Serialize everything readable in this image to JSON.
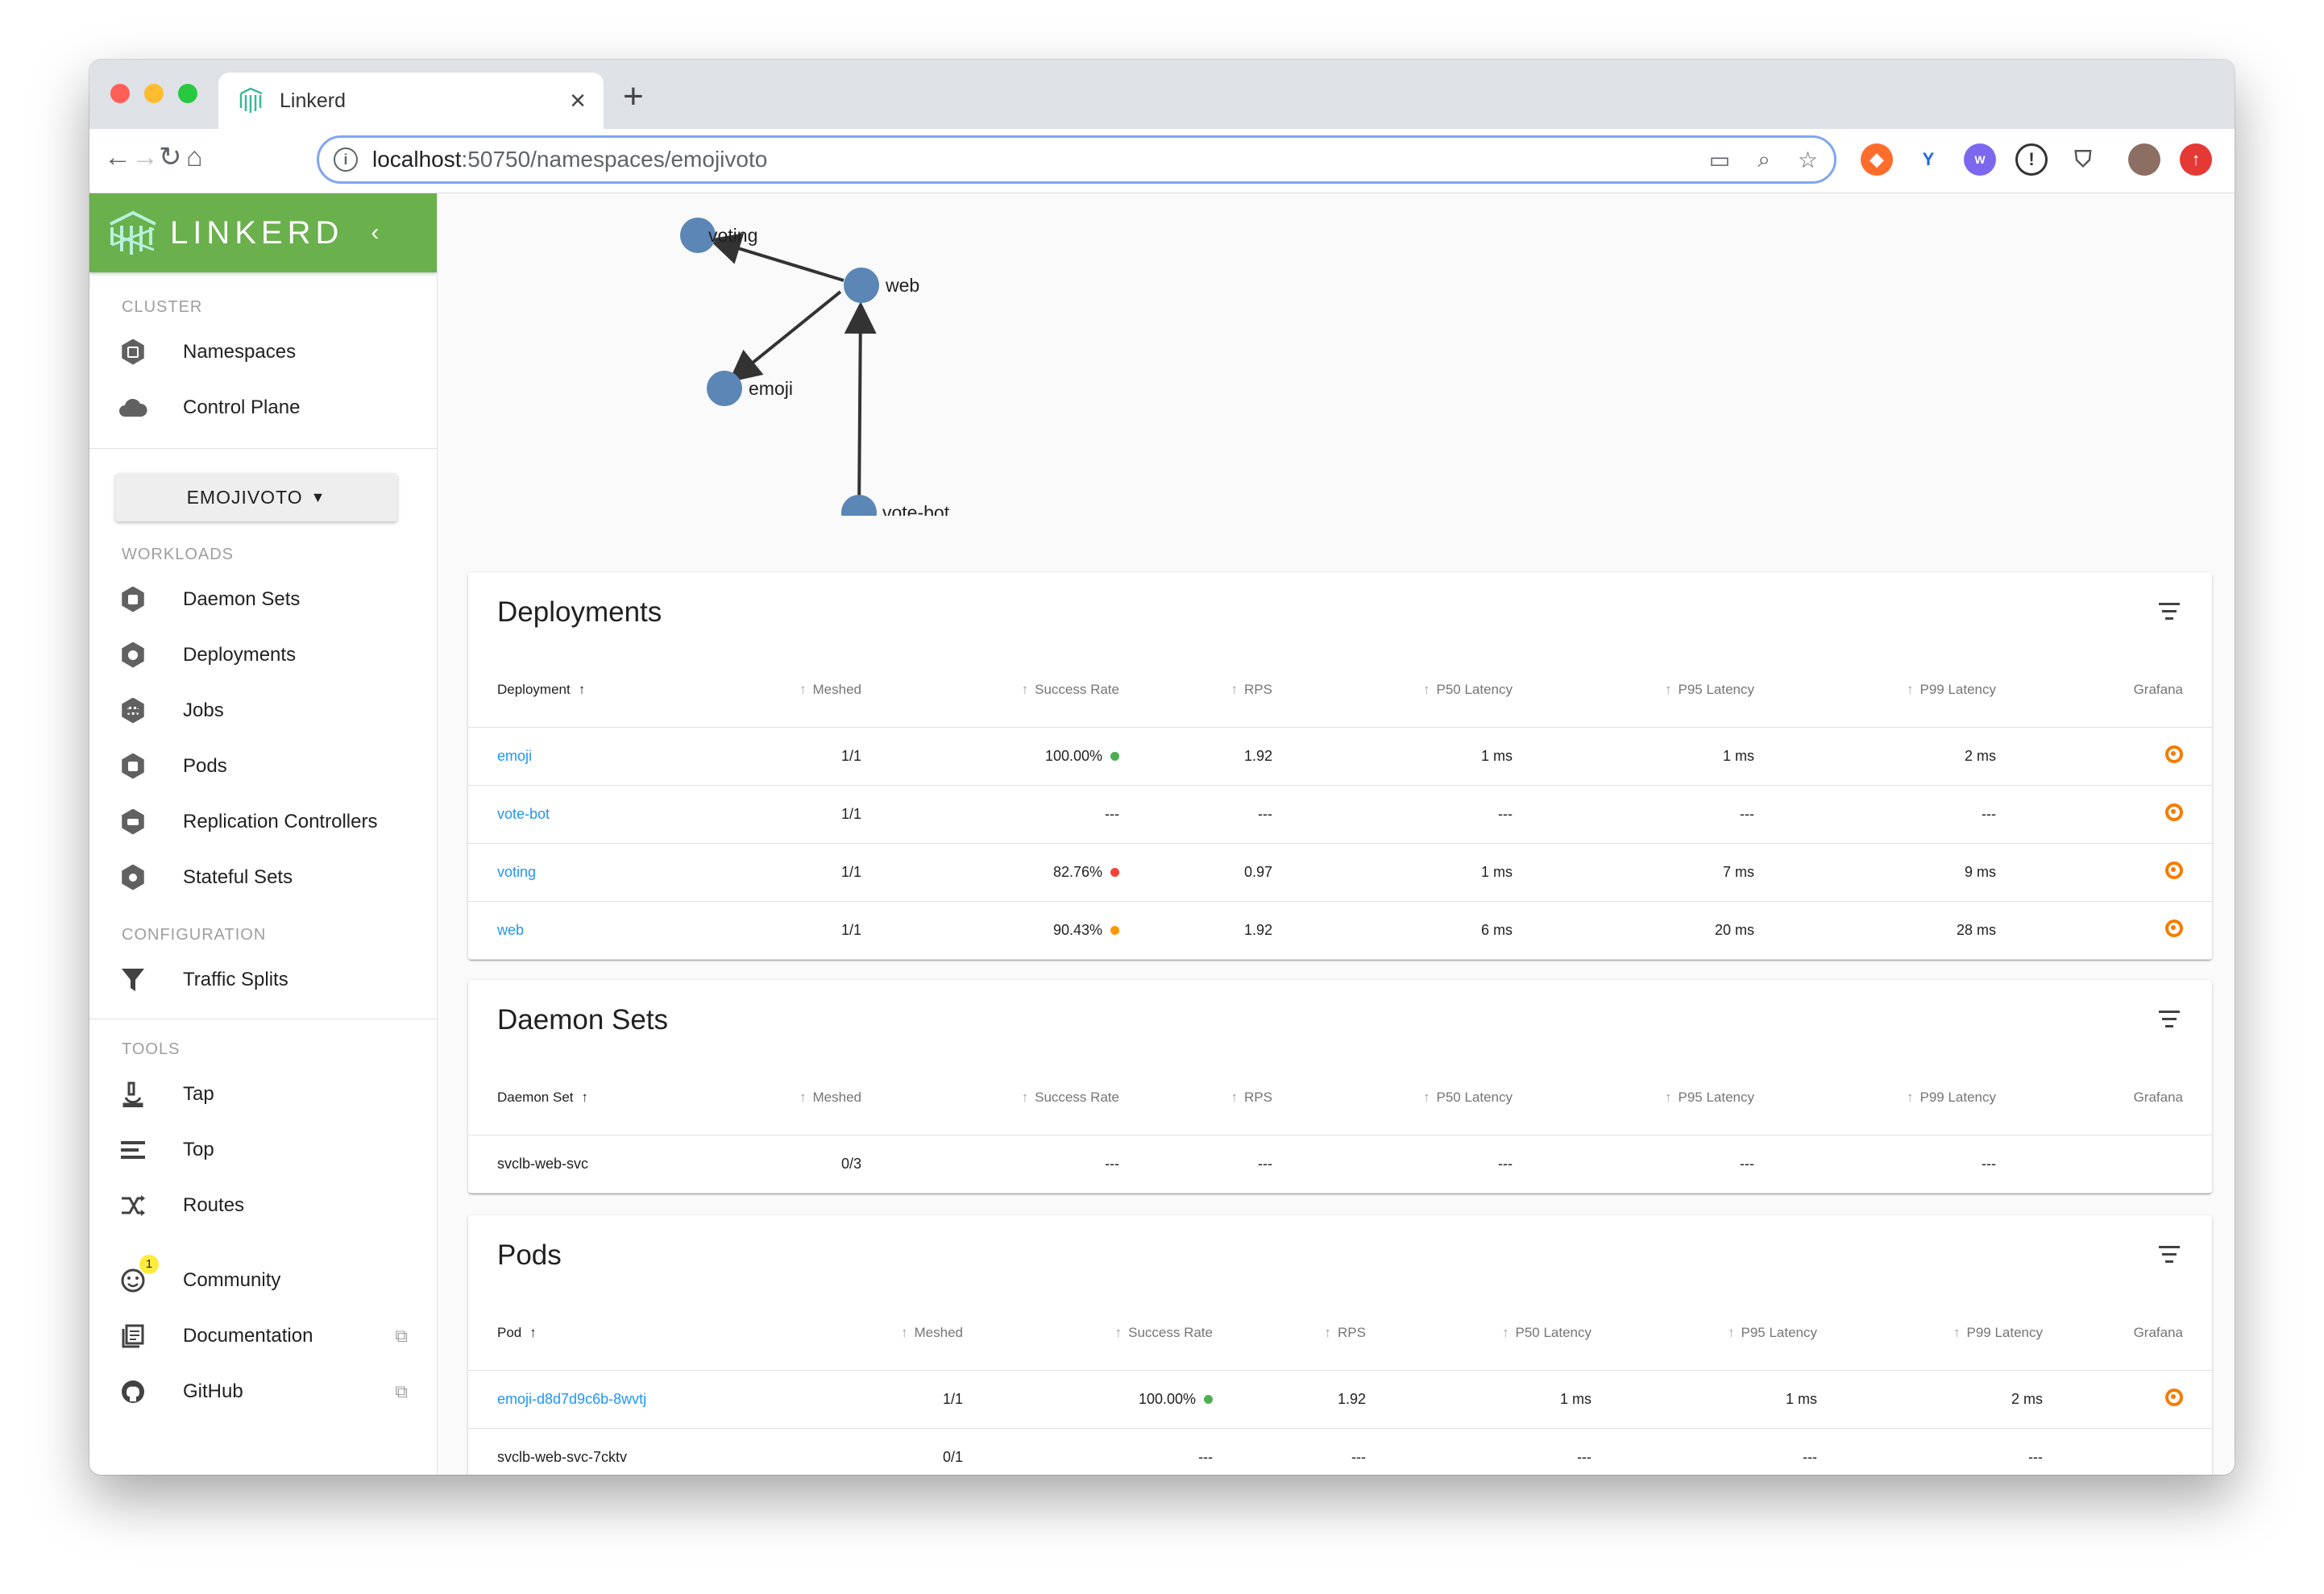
{
  "browser": {
    "tab_title": "Linkerd",
    "new_tab": "+",
    "close_tab": "×",
    "url_host": "localhost",
    "url_rest": ":50750/namespaces/emojivoto"
  },
  "sidebar": {
    "brand": "LINKERD",
    "collapse": "‹",
    "cluster_title": "CLUSTER",
    "cluster_items": [
      {
        "label": "Namespaces",
        "icon": "namespace-icon"
      },
      {
        "label": "Control Plane",
        "icon": "cloud-icon"
      }
    ],
    "namespace_button": "EMOJIVOTO",
    "workloads_title": "WORKLOADS",
    "workload_items": [
      {
        "label": "Daemon Sets",
        "icon": "daemonset-icon"
      },
      {
        "label": "Deployments",
        "icon": "deployment-icon"
      },
      {
        "label": "Jobs",
        "icon": "job-icon"
      },
      {
        "label": "Pods",
        "icon": "pod-icon"
      },
      {
        "label": "Replication Controllers",
        "icon": "replication-controller-icon"
      },
      {
        "label": "Stateful Sets",
        "icon": "statefulset-icon"
      }
    ],
    "configuration_title": "CONFIGURATION",
    "configuration_items": [
      {
        "label": "Traffic Splits",
        "icon": "filter-funnel-icon"
      }
    ],
    "tools_title": "TOOLS",
    "tools_items": [
      {
        "label": "Tap",
        "icon": "microscope-icon"
      },
      {
        "label": "Top",
        "icon": "list-icon"
      },
      {
        "label": "Routes",
        "icon": "shuffle-icon"
      }
    ],
    "extra_items": [
      {
        "label": "Community",
        "icon": "smiley-icon",
        "badge": "1"
      },
      {
        "label": "Documentation",
        "icon": "book-icon"
      },
      {
        "label": "GitHub",
        "icon": "github-icon"
      }
    ]
  },
  "graph": {
    "nodes": [
      "voting",
      "web",
      "emoji",
      "vote-bot"
    ],
    "edges": [
      [
        "web",
        "voting"
      ],
      [
        "web",
        "emoji"
      ],
      [
        "vote-bot",
        "web"
      ]
    ]
  },
  "deployments": {
    "title": "Deployments",
    "columns": [
      "Deployment",
      "Meshed",
      "Success Rate",
      "RPS",
      "P50 Latency",
      "P95 Latency",
      "P99 Latency",
      "Grafana"
    ],
    "rows": [
      {
        "name": "emoji",
        "meshed": "1/1",
        "success": "100.00%",
        "status": "#4caf50",
        "rps": "1.92",
        "p50": "1 ms",
        "p95": "1 ms",
        "p99": "2 ms"
      },
      {
        "name": "vote-bot",
        "meshed": "1/1",
        "success": "---",
        "status": "",
        "rps": "---",
        "p50": "---",
        "p95": "---",
        "p99": "---"
      },
      {
        "name": "voting",
        "meshed": "1/1",
        "success": "82.76%",
        "status": "#f44336",
        "rps": "0.97",
        "p50": "1 ms",
        "p95": "7 ms",
        "p99": "9 ms"
      },
      {
        "name": "web",
        "meshed": "1/1",
        "success": "90.43%",
        "status": "#ff9800",
        "rps": "1.92",
        "p50": "6 ms",
        "p95": "20 ms",
        "p99": "28 ms"
      }
    ]
  },
  "daemon_sets": {
    "title": "Daemon Sets",
    "columns": [
      "Daemon Set",
      "Meshed",
      "Success Rate",
      "RPS",
      "P50 Latency",
      "P95 Latency",
      "P99 Latency",
      "Grafana"
    ],
    "rows": [
      {
        "name": "svclb-web-svc",
        "meshed": "0/3",
        "success": "---",
        "rps": "---",
        "p50": "---",
        "p95": "---",
        "p99": "---"
      }
    ]
  },
  "pods": {
    "title": "Pods",
    "columns": [
      "Pod",
      "Meshed",
      "Success Rate",
      "RPS",
      "P50 Latency",
      "P95 Latency",
      "P99 Latency",
      "Grafana"
    ],
    "rows": [
      {
        "name": "emoji-d8d7d9c6b-8wvtj",
        "meshed": "1/1",
        "success": "100.00%",
        "status": "#4caf50",
        "rps": "1.92",
        "p50": "1 ms",
        "p95": "1 ms",
        "p99": "2 ms"
      },
      {
        "name": "svclb-web-svc-7cktv",
        "meshed": "0/1",
        "success": "---",
        "status": "",
        "rps": "---",
        "p50": "---",
        "p95": "---",
        "p99": "---"
      }
    ]
  },
  "colors": {
    "brand_green": "#6ab04c",
    "link_blue": "#2196f3",
    "node_blue": "#5b86b5"
  }
}
